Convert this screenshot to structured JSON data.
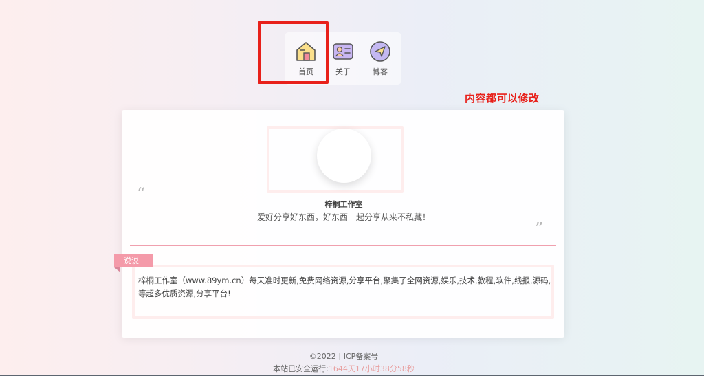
{
  "nav": {
    "items": [
      {
        "label": "首页",
        "icon": "home-icon"
      },
      {
        "label": "关于",
        "icon": "profile-card-icon"
      },
      {
        "label": "博客",
        "icon": "navigation-arrow-icon"
      }
    ]
  },
  "annotation": {
    "note": "内容都可以修改"
  },
  "profile": {
    "name": "梓桐工作室",
    "slogan": "爱好分享好东西，好东西一起分享从来不私藏！"
  },
  "talk": {
    "tag": "说说",
    "content": "梓桐工作室（www.89ym.cn）每天准时更新,免费网络资源,分享平台,聚集了全网资源,娱乐,技术,教程,软件,线报,源码,等超多优质资源,分享平台!"
  },
  "footer": {
    "copyright": "©2022丨ICP备案号",
    "runtime_label": "本站已安全运行:",
    "runtime_value": "1644天17小时38分58秒"
  },
  "colors": {
    "highlight": "#e8201a",
    "accent_pink": "#f49aa9"
  }
}
